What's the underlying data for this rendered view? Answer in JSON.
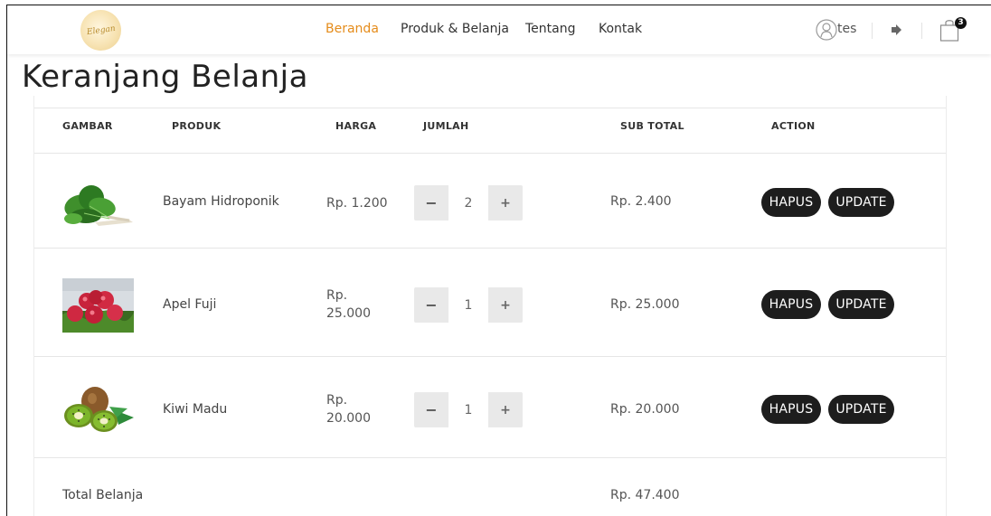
{
  "brand": {
    "logo_text": "Elegan"
  },
  "nav": {
    "items": [
      {
        "label": "Beranda",
        "active": true
      },
      {
        "label": "Produk & Belanja",
        "active": false
      },
      {
        "label": "Tentang",
        "active": false
      },
      {
        "label": "Kontak",
        "active": false
      }
    ],
    "active_color": "#e58c1b"
  },
  "user": {
    "name": "tes"
  },
  "cart_icon": {
    "badge_count": "3"
  },
  "page_title": "Keranjang Belanja",
  "table": {
    "headers": {
      "gambar": "GAMBAR",
      "produk": "PRODUK",
      "harga": "HARGA",
      "jumlah": "JUMLAH",
      "subtotal": "SUB TOTAL",
      "action": "ACTION"
    },
    "rows": [
      {
        "image": "spinach-image",
        "product": "Bayam Hidroponik",
        "price": "Rp. 1.200",
        "qty_minus": "−",
        "quantity": "2",
        "qty_plus": "+",
        "subtotal": "Rp. 2.400",
        "delete_label": "HAPUS",
        "update_label": "UPDATE"
      },
      {
        "image": "apple-image",
        "product": "Apel Fuji",
        "price": "Rp. 25.000",
        "qty_minus": "−",
        "quantity": "1",
        "qty_plus": "+",
        "subtotal": "Rp. 25.000",
        "delete_label": "HAPUS",
        "update_label": "UPDATE"
      },
      {
        "image": "kiwi-image",
        "product": "Kiwi Madu",
        "price": "Rp. 20.000",
        "qty_minus": "−",
        "quantity": "1",
        "qty_plus": "+",
        "subtotal": "Rp. 20.000",
        "delete_label": "HAPUS",
        "update_label": "UPDATE"
      }
    ]
  },
  "total": {
    "label": "Total Belanja",
    "value": "Rp. 47.400"
  },
  "colors": {
    "button_bg": "#1d1d1d",
    "qty_bg": "#e9e9e9"
  }
}
